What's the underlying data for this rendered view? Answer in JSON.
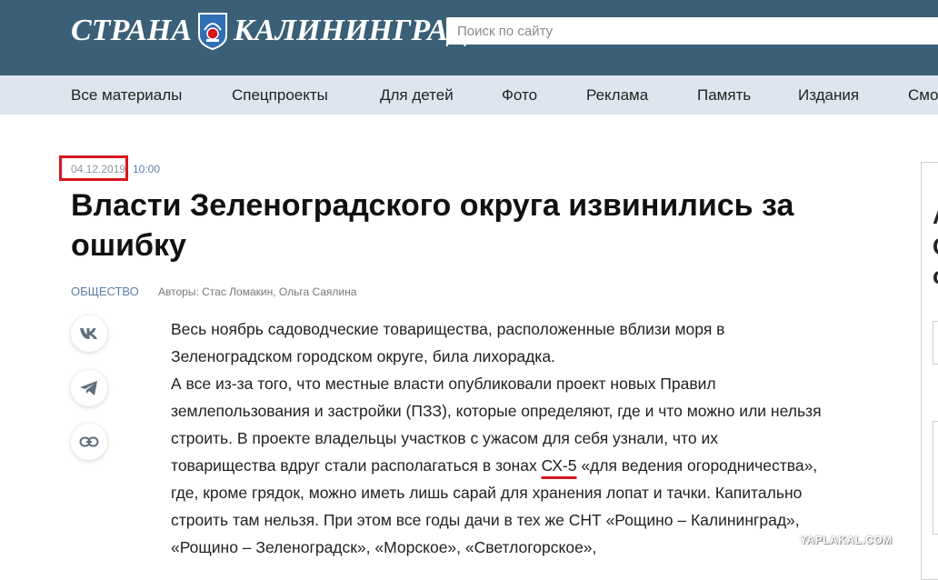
{
  "header": {
    "logo_left": "СТРАНА",
    "logo_right": "КАЛИНИНГРАД",
    "search_placeholder": "Поиск по сайту"
  },
  "nav": {
    "items": [
      {
        "label": "Все материалы"
      },
      {
        "label": "Спецпроекты"
      },
      {
        "label": "Для детей"
      },
      {
        "label": "Фото"
      },
      {
        "label": "Реклама"
      },
      {
        "label": "Память"
      },
      {
        "label": "Издания"
      },
      {
        "label": "Смо"
      }
    ]
  },
  "article": {
    "date": "04.12.2019",
    "time": "10:00",
    "title": "Власти Зеленоградского округа извинились за ошибку",
    "rubric": "ОБЩЕСТВО",
    "authors": "Авторы: Стас Ломакин, Ольга Саялина",
    "paragraphs": {
      "p1": "Весь ноябрь садоводческие товарищества, расположенные вблизи моря в Зеленоградском городском округе, била лихорадка.",
      "p2_before": "А все из-за того, что местные власти опубликовали проект новых Правил землепользования и застройки (ПЗЗ), которые определяют, где и что можно или нельзя строить. В проекте владельцы участков с ужасом для себя узнали, что их товарищества вдруг стали располагаться в зонах ",
      "p2_highlight": "СХ-5",
      "p2_after": " «для ведения огородничества», где, кроме грядок, можно иметь лишь сарай для хранения лопат и тачки. Капитально строить там нельзя. При этом все годы дачи в тех же СНТ «Рощино – Калининград», «Рощино – Зеленоградск», «Морское», «Светлогорское»,"
    }
  },
  "share": {
    "vk_icon": "vk-icon",
    "telegram_icon": "telegram-icon",
    "link_icon": "link-icon"
  },
  "sidebar": {
    "chars": [
      "А",
      "С",
      "о"
    ]
  },
  "watermark": "YAPLAKAL.COM",
  "colors": {
    "header_bg": "#3b5f76",
    "nav_bg": "#dde6ef",
    "highlight_red": "#d8161c",
    "link_blue": "#5a7fa8"
  }
}
